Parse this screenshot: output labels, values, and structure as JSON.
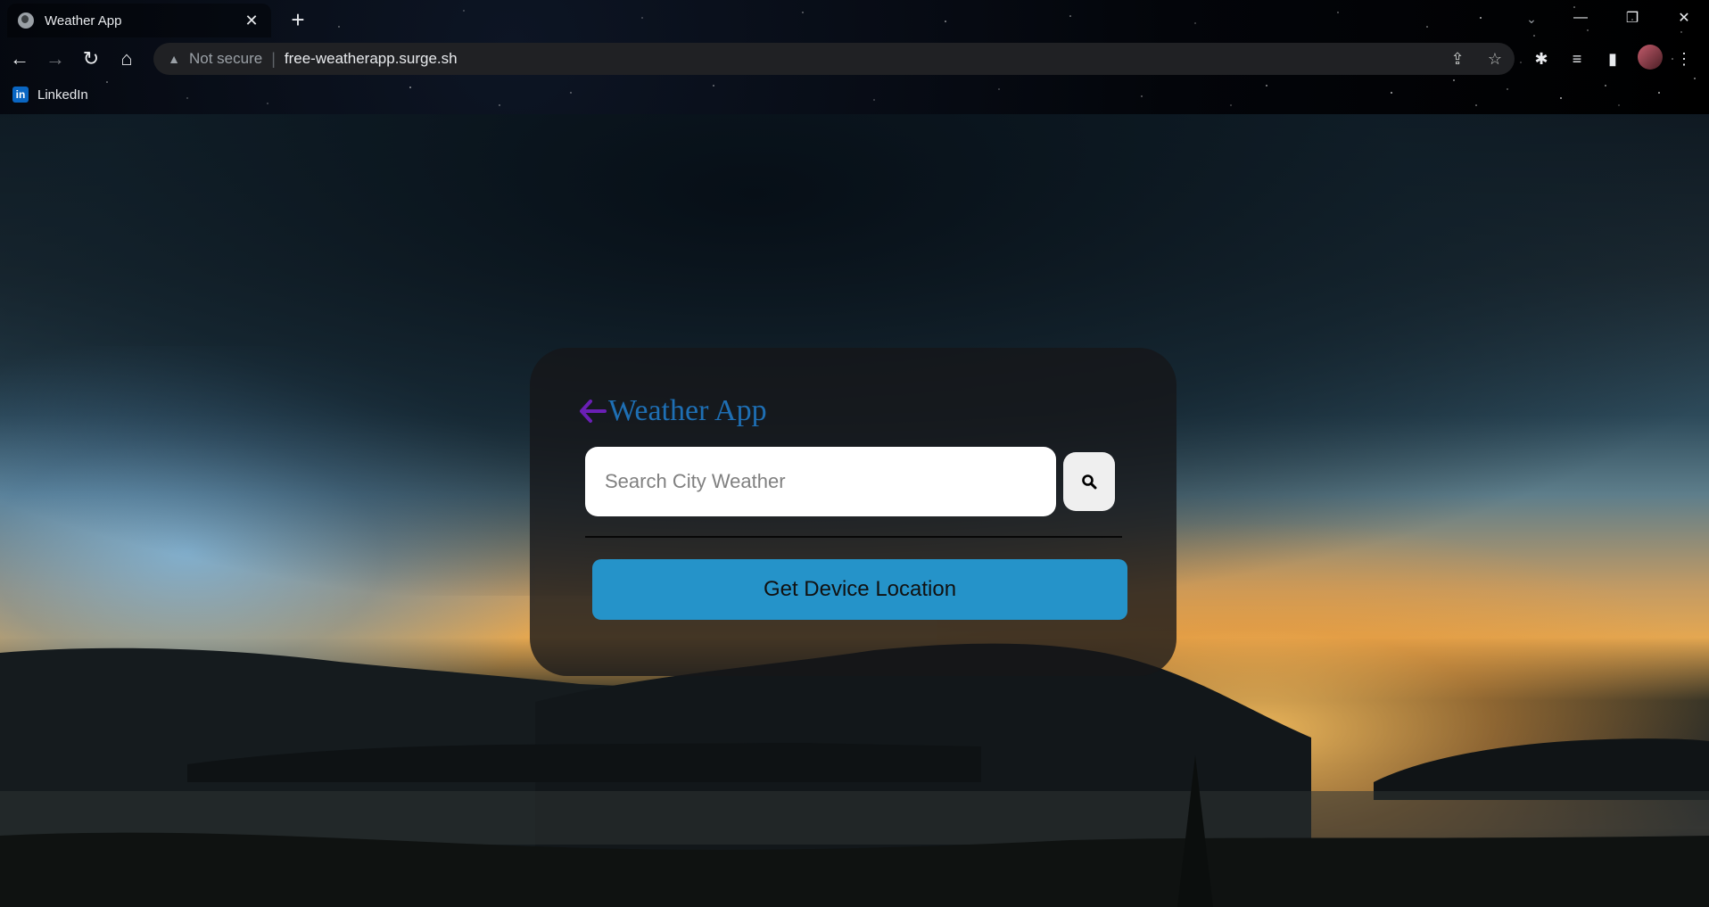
{
  "browser": {
    "tab": {
      "title": "Weather App",
      "favicon": "globe-icon",
      "close": "✕"
    },
    "new_tab": "+",
    "address": {
      "security_label": "Not secure",
      "separator": "|",
      "url": "free-weatherapp.surge.sh"
    },
    "bookmarks": [
      {
        "label": "LinkedIn",
        "icon": "linkedin-icon"
      }
    ]
  },
  "app": {
    "title": "Weather App",
    "search": {
      "placeholder": "Search City Weather",
      "value": ""
    },
    "location_button": "Get Device Location",
    "colors": {
      "title": "#1e6fb4",
      "arrow": "#6a1fb5",
      "button": "#2593c9",
      "card": "#161618"
    }
  }
}
